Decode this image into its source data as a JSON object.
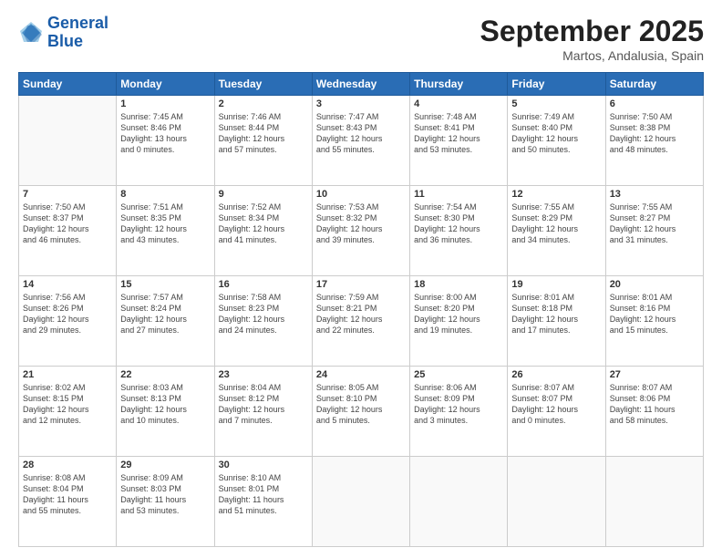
{
  "logo": {
    "line1": "General",
    "line2": "Blue"
  },
  "title": "September 2025",
  "location": "Martos, Andalusia, Spain",
  "weekdays": [
    "Sunday",
    "Monday",
    "Tuesday",
    "Wednesday",
    "Thursday",
    "Friday",
    "Saturday"
  ],
  "weeks": [
    [
      {
        "day": "",
        "info": ""
      },
      {
        "day": "1",
        "info": "Sunrise: 7:45 AM\nSunset: 8:46 PM\nDaylight: 13 hours\nand 0 minutes."
      },
      {
        "day": "2",
        "info": "Sunrise: 7:46 AM\nSunset: 8:44 PM\nDaylight: 12 hours\nand 57 minutes."
      },
      {
        "day": "3",
        "info": "Sunrise: 7:47 AM\nSunset: 8:43 PM\nDaylight: 12 hours\nand 55 minutes."
      },
      {
        "day": "4",
        "info": "Sunrise: 7:48 AM\nSunset: 8:41 PM\nDaylight: 12 hours\nand 53 minutes."
      },
      {
        "day": "5",
        "info": "Sunrise: 7:49 AM\nSunset: 8:40 PM\nDaylight: 12 hours\nand 50 minutes."
      },
      {
        "day": "6",
        "info": "Sunrise: 7:50 AM\nSunset: 8:38 PM\nDaylight: 12 hours\nand 48 minutes."
      }
    ],
    [
      {
        "day": "7",
        "info": "Sunrise: 7:50 AM\nSunset: 8:37 PM\nDaylight: 12 hours\nand 46 minutes."
      },
      {
        "day": "8",
        "info": "Sunrise: 7:51 AM\nSunset: 8:35 PM\nDaylight: 12 hours\nand 43 minutes."
      },
      {
        "day": "9",
        "info": "Sunrise: 7:52 AM\nSunset: 8:34 PM\nDaylight: 12 hours\nand 41 minutes."
      },
      {
        "day": "10",
        "info": "Sunrise: 7:53 AM\nSunset: 8:32 PM\nDaylight: 12 hours\nand 39 minutes."
      },
      {
        "day": "11",
        "info": "Sunrise: 7:54 AM\nSunset: 8:30 PM\nDaylight: 12 hours\nand 36 minutes."
      },
      {
        "day": "12",
        "info": "Sunrise: 7:55 AM\nSunset: 8:29 PM\nDaylight: 12 hours\nand 34 minutes."
      },
      {
        "day": "13",
        "info": "Sunrise: 7:55 AM\nSunset: 8:27 PM\nDaylight: 12 hours\nand 31 minutes."
      }
    ],
    [
      {
        "day": "14",
        "info": "Sunrise: 7:56 AM\nSunset: 8:26 PM\nDaylight: 12 hours\nand 29 minutes."
      },
      {
        "day": "15",
        "info": "Sunrise: 7:57 AM\nSunset: 8:24 PM\nDaylight: 12 hours\nand 27 minutes."
      },
      {
        "day": "16",
        "info": "Sunrise: 7:58 AM\nSunset: 8:23 PM\nDaylight: 12 hours\nand 24 minutes."
      },
      {
        "day": "17",
        "info": "Sunrise: 7:59 AM\nSunset: 8:21 PM\nDaylight: 12 hours\nand 22 minutes."
      },
      {
        "day": "18",
        "info": "Sunrise: 8:00 AM\nSunset: 8:20 PM\nDaylight: 12 hours\nand 19 minutes."
      },
      {
        "day": "19",
        "info": "Sunrise: 8:01 AM\nSunset: 8:18 PM\nDaylight: 12 hours\nand 17 minutes."
      },
      {
        "day": "20",
        "info": "Sunrise: 8:01 AM\nSunset: 8:16 PM\nDaylight: 12 hours\nand 15 minutes."
      }
    ],
    [
      {
        "day": "21",
        "info": "Sunrise: 8:02 AM\nSunset: 8:15 PM\nDaylight: 12 hours\nand 12 minutes."
      },
      {
        "day": "22",
        "info": "Sunrise: 8:03 AM\nSunset: 8:13 PM\nDaylight: 12 hours\nand 10 minutes."
      },
      {
        "day": "23",
        "info": "Sunrise: 8:04 AM\nSunset: 8:12 PM\nDaylight: 12 hours\nand 7 minutes."
      },
      {
        "day": "24",
        "info": "Sunrise: 8:05 AM\nSunset: 8:10 PM\nDaylight: 12 hours\nand 5 minutes."
      },
      {
        "day": "25",
        "info": "Sunrise: 8:06 AM\nSunset: 8:09 PM\nDaylight: 12 hours\nand 3 minutes."
      },
      {
        "day": "26",
        "info": "Sunrise: 8:07 AM\nSunset: 8:07 PM\nDaylight: 12 hours\nand 0 minutes."
      },
      {
        "day": "27",
        "info": "Sunrise: 8:07 AM\nSunset: 8:06 PM\nDaylight: 11 hours\nand 58 minutes."
      }
    ],
    [
      {
        "day": "28",
        "info": "Sunrise: 8:08 AM\nSunset: 8:04 PM\nDaylight: 11 hours\nand 55 minutes."
      },
      {
        "day": "29",
        "info": "Sunrise: 8:09 AM\nSunset: 8:03 PM\nDaylight: 11 hours\nand 53 minutes."
      },
      {
        "day": "30",
        "info": "Sunrise: 8:10 AM\nSunset: 8:01 PM\nDaylight: 11 hours\nand 51 minutes."
      },
      {
        "day": "",
        "info": ""
      },
      {
        "day": "",
        "info": ""
      },
      {
        "day": "",
        "info": ""
      },
      {
        "day": "",
        "info": ""
      }
    ]
  ]
}
